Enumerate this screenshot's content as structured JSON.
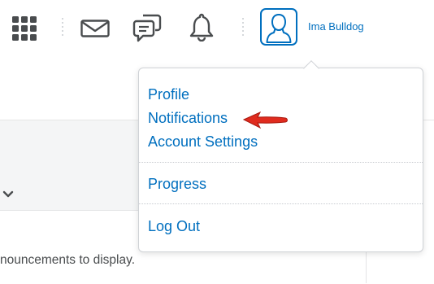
{
  "topbar": {
    "icons": {
      "apps": "waffle-grid-icon",
      "messages": "envelope-icon",
      "chat": "speech-bubble-icon",
      "notifications": "bell-icon",
      "avatar": "person-icon"
    },
    "user_name": "Ima Bulldog"
  },
  "dropdown": {
    "items": [
      {
        "label": "Profile"
      },
      {
        "label": "Notifications"
      },
      {
        "label": "Account Settings"
      },
      {
        "label": "Progress"
      },
      {
        "label": "Log Out"
      }
    ]
  },
  "background": {
    "announcement_text": "nouncements to display."
  },
  "colors": {
    "link_blue": "#006fbf",
    "icon_gray": "#494c4e",
    "arrow_red": "#e02b1e"
  }
}
